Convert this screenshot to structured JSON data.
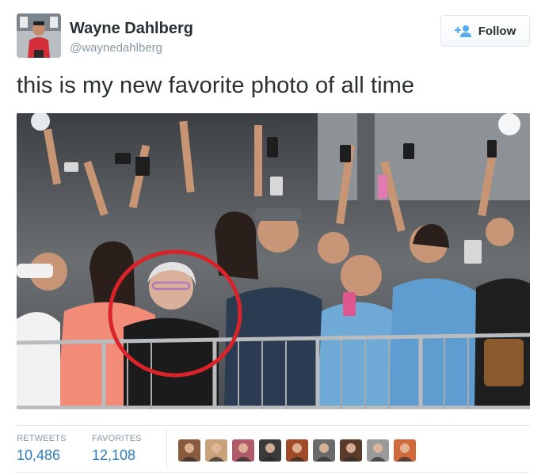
{
  "user": {
    "display_name": "Wayne Dahlberg",
    "screen_name": "@waynedahlberg",
    "avatar_icon": "profile-photo"
  },
  "follow_button": {
    "label": "Follow",
    "icon": "add-person-icon",
    "accent": "#55acee"
  },
  "tweet": {
    "text": "this is my new favorite photo of all time",
    "photo_description_icon": "crowd-photo",
    "highlight_color": "#d8232a"
  },
  "stats": {
    "retweets_label": "RETWEETS",
    "retweets_value": "10,486",
    "favorites_label": "FAVORITES",
    "favorites_value": "12,108",
    "link_color": "#2b7bb9"
  },
  "favoriters": [
    {
      "name": "favoriter-avatar-1",
      "color": "#8a5a3c"
    },
    {
      "name": "favoriter-avatar-2",
      "color": "#c9a27a"
    },
    {
      "name": "favoriter-avatar-3",
      "color": "#b05a6a"
    },
    {
      "name": "favoriter-avatar-4",
      "color": "#3a3a3a"
    },
    {
      "name": "favoriter-avatar-5",
      "color": "#a04a2a"
    },
    {
      "name": "favoriter-avatar-6",
      "color": "#6a6a6a"
    },
    {
      "name": "favoriter-avatar-7",
      "color": "#5a3a2a"
    },
    {
      "name": "favoriter-avatar-8",
      "color": "#9a9a9a"
    },
    {
      "name": "favoriter-avatar-9",
      "color": "#d06a3a"
    }
  ]
}
